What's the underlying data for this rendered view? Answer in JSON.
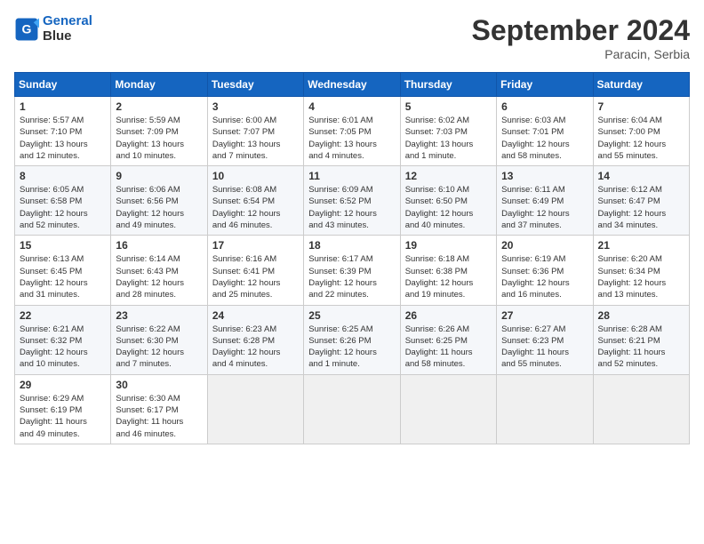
{
  "header": {
    "logo": "GeneralBlue",
    "title": "September 2024",
    "subtitle": "Paracin, Serbia"
  },
  "weekdays": [
    "Sunday",
    "Monday",
    "Tuesday",
    "Wednesday",
    "Thursday",
    "Friday",
    "Saturday"
  ],
  "weeks": [
    [
      {
        "day": "1",
        "info": "Sunrise: 5:57 AM\nSunset: 7:10 PM\nDaylight: 13 hours\nand 12 minutes."
      },
      {
        "day": "2",
        "info": "Sunrise: 5:59 AM\nSunset: 7:09 PM\nDaylight: 13 hours\nand 10 minutes."
      },
      {
        "day": "3",
        "info": "Sunrise: 6:00 AM\nSunset: 7:07 PM\nDaylight: 13 hours\nand 7 minutes."
      },
      {
        "day": "4",
        "info": "Sunrise: 6:01 AM\nSunset: 7:05 PM\nDaylight: 13 hours\nand 4 minutes."
      },
      {
        "day": "5",
        "info": "Sunrise: 6:02 AM\nSunset: 7:03 PM\nDaylight: 13 hours\nand 1 minute."
      },
      {
        "day": "6",
        "info": "Sunrise: 6:03 AM\nSunset: 7:01 PM\nDaylight: 12 hours\nand 58 minutes."
      },
      {
        "day": "7",
        "info": "Sunrise: 6:04 AM\nSunset: 7:00 PM\nDaylight: 12 hours\nand 55 minutes."
      }
    ],
    [
      {
        "day": "8",
        "info": "Sunrise: 6:05 AM\nSunset: 6:58 PM\nDaylight: 12 hours\nand 52 minutes."
      },
      {
        "day": "9",
        "info": "Sunrise: 6:06 AM\nSunset: 6:56 PM\nDaylight: 12 hours\nand 49 minutes."
      },
      {
        "day": "10",
        "info": "Sunrise: 6:08 AM\nSunset: 6:54 PM\nDaylight: 12 hours\nand 46 minutes."
      },
      {
        "day": "11",
        "info": "Sunrise: 6:09 AM\nSunset: 6:52 PM\nDaylight: 12 hours\nand 43 minutes."
      },
      {
        "day": "12",
        "info": "Sunrise: 6:10 AM\nSunset: 6:50 PM\nDaylight: 12 hours\nand 40 minutes."
      },
      {
        "day": "13",
        "info": "Sunrise: 6:11 AM\nSunset: 6:49 PM\nDaylight: 12 hours\nand 37 minutes."
      },
      {
        "day": "14",
        "info": "Sunrise: 6:12 AM\nSunset: 6:47 PM\nDaylight: 12 hours\nand 34 minutes."
      }
    ],
    [
      {
        "day": "15",
        "info": "Sunrise: 6:13 AM\nSunset: 6:45 PM\nDaylight: 12 hours\nand 31 minutes."
      },
      {
        "day": "16",
        "info": "Sunrise: 6:14 AM\nSunset: 6:43 PM\nDaylight: 12 hours\nand 28 minutes."
      },
      {
        "day": "17",
        "info": "Sunrise: 6:16 AM\nSunset: 6:41 PM\nDaylight: 12 hours\nand 25 minutes."
      },
      {
        "day": "18",
        "info": "Sunrise: 6:17 AM\nSunset: 6:39 PM\nDaylight: 12 hours\nand 22 minutes."
      },
      {
        "day": "19",
        "info": "Sunrise: 6:18 AM\nSunset: 6:38 PM\nDaylight: 12 hours\nand 19 minutes."
      },
      {
        "day": "20",
        "info": "Sunrise: 6:19 AM\nSunset: 6:36 PM\nDaylight: 12 hours\nand 16 minutes."
      },
      {
        "day": "21",
        "info": "Sunrise: 6:20 AM\nSunset: 6:34 PM\nDaylight: 12 hours\nand 13 minutes."
      }
    ],
    [
      {
        "day": "22",
        "info": "Sunrise: 6:21 AM\nSunset: 6:32 PM\nDaylight: 12 hours\nand 10 minutes."
      },
      {
        "day": "23",
        "info": "Sunrise: 6:22 AM\nSunset: 6:30 PM\nDaylight: 12 hours\nand 7 minutes."
      },
      {
        "day": "24",
        "info": "Sunrise: 6:23 AM\nSunset: 6:28 PM\nDaylight: 12 hours\nand 4 minutes."
      },
      {
        "day": "25",
        "info": "Sunrise: 6:25 AM\nSunset: 6:26 PM\nDaylight: 12 hours\nand 1 minute."
      },
      {
        "day": "26",
        "info": "Sunrise: 6:26 AM\nSunset: 6:25 PM\nDaylight: 11 hours\nand 58 minutes."
      },
      {
        "day": "27",
        "info": "Sunrise: 6:27 AM\nSunset: 6:23 PM\nDaylight: 11 hours\nand 55 minutes."
      },
      {
        "day": "28",
        "info": "Sunrise: 6:28 AM\nSunset: 6:21 PM\nDaylight: 11 hours\nand 52 minutes."
      }
    ],
    [
      {
        "day": "29",
        "info": "Sunrise: 6:29 AM\nSunset: 6:19 PM\nDaylight: 11 hours\nand 49 minutes."
      },
      {
        "day": "30",
        "info": "Sunrise: 6:30 AM\nSunset: 6:17 PM\nDaylight: 11 hours\nand 46 minutes."
      },
      {
        "day": "",
        "info": ""
      },
      {
        "day": "",
        "info": ""
      },
      {
        "day": "",
        "info": ""
      },
      {
        "day": "",
        "info": ""
      },
      {
        "day": "",
        "info": ""
      }
    ]
  ]
}
